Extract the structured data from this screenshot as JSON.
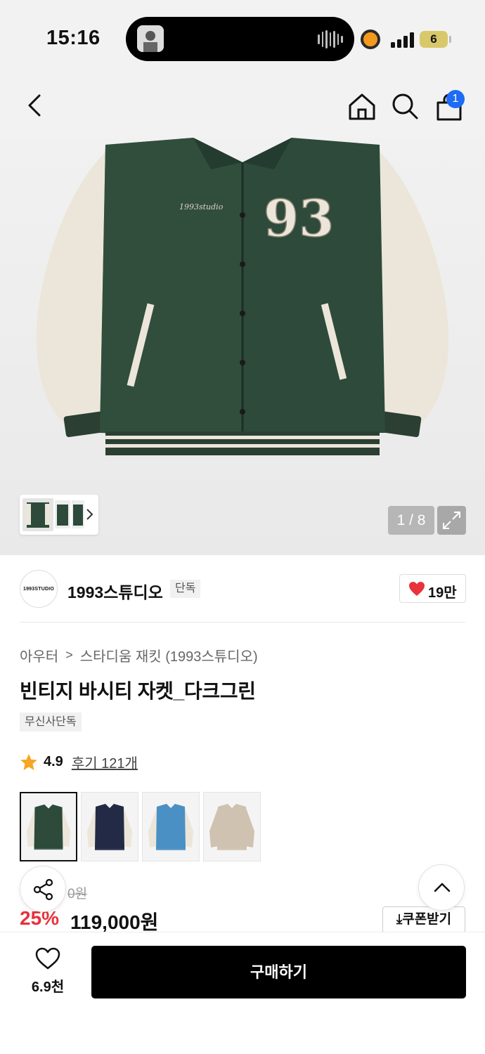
{
  "status_bar": {
    "time": "15:16",
    "battery": "6"
  },
  "nav": {
    "cart_count": "1",
    "icons": [
      "back-icon",
      "home-icon",
      "search-icon",
      "cart-icon"
    ]
  },
  "gallery": {
    "pager": "1 / 8"
  },
  "brand": {
    "logo_text": "1993STUDIO",
    "name": "1993스튜디오",
    "tag": "단독",
    "likes": "19만"
  },
  "product": {
    "breadcrumb": [
      "아우터",
      "스타디움 재킷 (1993스튜디오)"
    ],
    "title": "빈티지 바시티 자켓_다크그린",
    "exclusive_tag": "무신사단독",
    "rating": "4.9",
    "reviews": "후기 121개"
  },
  "options": [
    {
      "name": "다크그린",
      "body": "#2d4a3b",
      "sleeve": "#ece6da"
    },
    {
      "name": "네이비",
      "body": "#232a45",
      "sleeve": "#ece6da"
    },
    {
      "name": "블루",
      "body": "#4a90c4",
      "sleeve": "#ece6da"
    },
    {
      "name": "베이지",
      "body": "#cfc2b0",
      "sleeve": "#cfc2b0"
    }
  ],
  "price": {
    "original": "0원",
    "discount": "25%",
    "sale": "119,000원",
    "coupon": "⤓쿠폰받기"
  },
  "bottom": {
    "wish_count": "6.9천",
    "buy_label": "구매하기"
  },
  "colors": {
    "accent_red": "#e8323c",
    "badge_blue": "#1e6bf5",
    "star": "#f5a623"
  }
}
